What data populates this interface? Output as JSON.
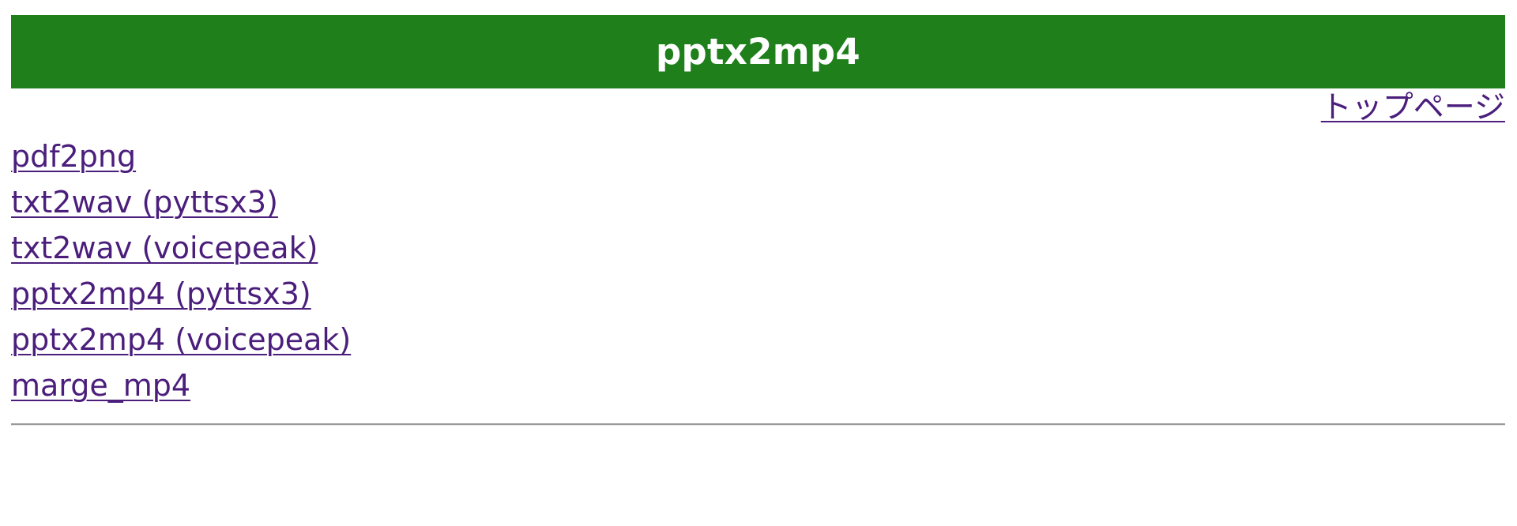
{
  "header": {
    "title": "pptx2mp4",
    "background_color": "#1f7f1b"
  },
  "top_link": {
    "label": "トップページ"
  },
  "nav": {
    "link_color": "#4b1e7c",
    "items": [
      {
        "label": "pdf2png"
      },
      {
        "label": "txt2wav (pyttsx3)"
      },
      {
        "label": "txt2wav (voicepeak)"
      },
      {
        "label": "pptx2mp4 (pyttsx3)"
      },
      {
        "label": "pptx2mp4 (voicepeak)"
      },
      {
        "label": "marge_mp4"
      }
    ]
  }
}
